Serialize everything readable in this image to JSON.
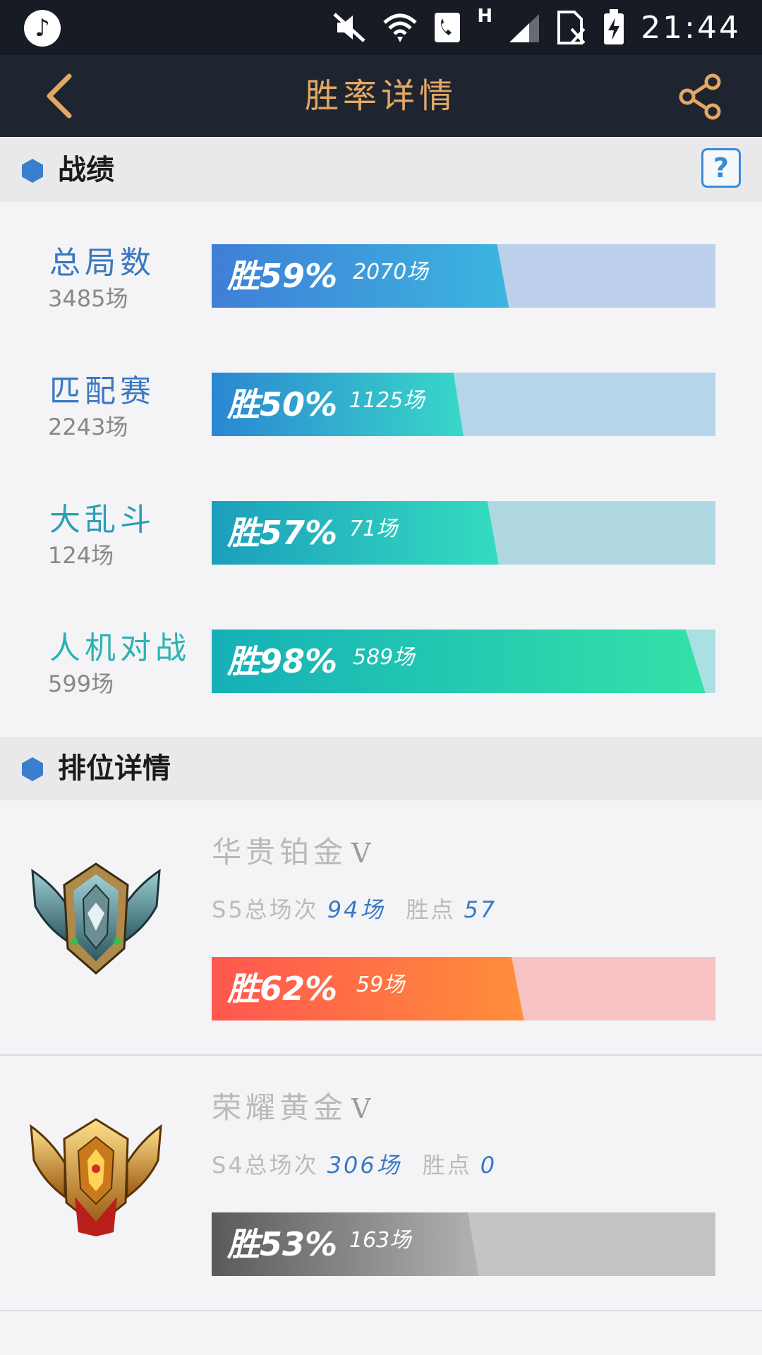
{
  "status_bar": {
    "time": "21:44",
    "network": "H"
  },
  "header": {
    "title": "胜率详情"
  },
  "record_section": {
    "title": "战绩",
    "help": "?"
  },
  "stats": [
    {
      "name": "总局数",
      "count": "3485场",
      "win_label": "胜59%",
      "games": "2070场",
      "win_rate": 0.59,
      "name_color": "#3a78c2",
      "fill_from": "#3f7fd6",
      "fill_to": "#3cb5e0",
      "track": "#bcd0eb"
    },
    {
      "name": "匹配赛",
      "count": "2243场",
      "win_label": "胜50%",
      "games": "1125场",
      "win_rate": 0.5,
      "name_color": "#3a78c2",
      "fill_from": "#2b86d2",
      "fill_to": "#38d8c8",
      "track": "#b5d6ea"
    },
    {
      "name": "大乱斗",
      "count": "124场",
      "win_label": "胜57%",
      "games": "71场",
      "win_rate": 0.57,
      "name_color": "#2a9fb8",
      "fill_from": "#1b9fbc",
      "fill_to": "#35dcc0",
      "track": "#aed7e2"
    },
    {
      "name": "人机对战",
      "count": "599场",
      "win_label": "胜98%",
      "games": "589场",
      "win_rate": 0.98,
      "name_color": "#2ab3b4",
      "fill_from": "#15b0b8",
      "fill_to": "#35e2a8",
      "track": "#abe0e3"
    }
  ],
  "ranked_section": {
    "title": "排位详情"
  },
  "ranked": [
    {
      "name": "华贵铂金",
      "tier": "V",
      "season_label": "S5总场次",
      "season_games": "94场",
      "points_label": "胜点",
      "points": "57",
      "win_label": "胜62%",
      "games": "59场",
      "win_rate": 0.62,
      "fill_from": "#ff5650",
      "fill_to": "#ff8e3a",
      "track": "#f6c2c3",
      "emblem": "platinum-emblem"
    },
    {
      "name": "荣耀黄金",
      "tier": "V",
      "season_label": "S4总场次",
      "season_games": "306场",
      "points_label": "胜点",
      "points": "0",
      "win_label": "胜53%",
      "games": "163场",
      "win_rate": 0.53,
      "fill_from": "#5a5a5a",
      "fill_to": "#b2b2b2",
      "track": "#c4c4c4",
      "emblem": "gold-emblem"
    }
  ]
}
